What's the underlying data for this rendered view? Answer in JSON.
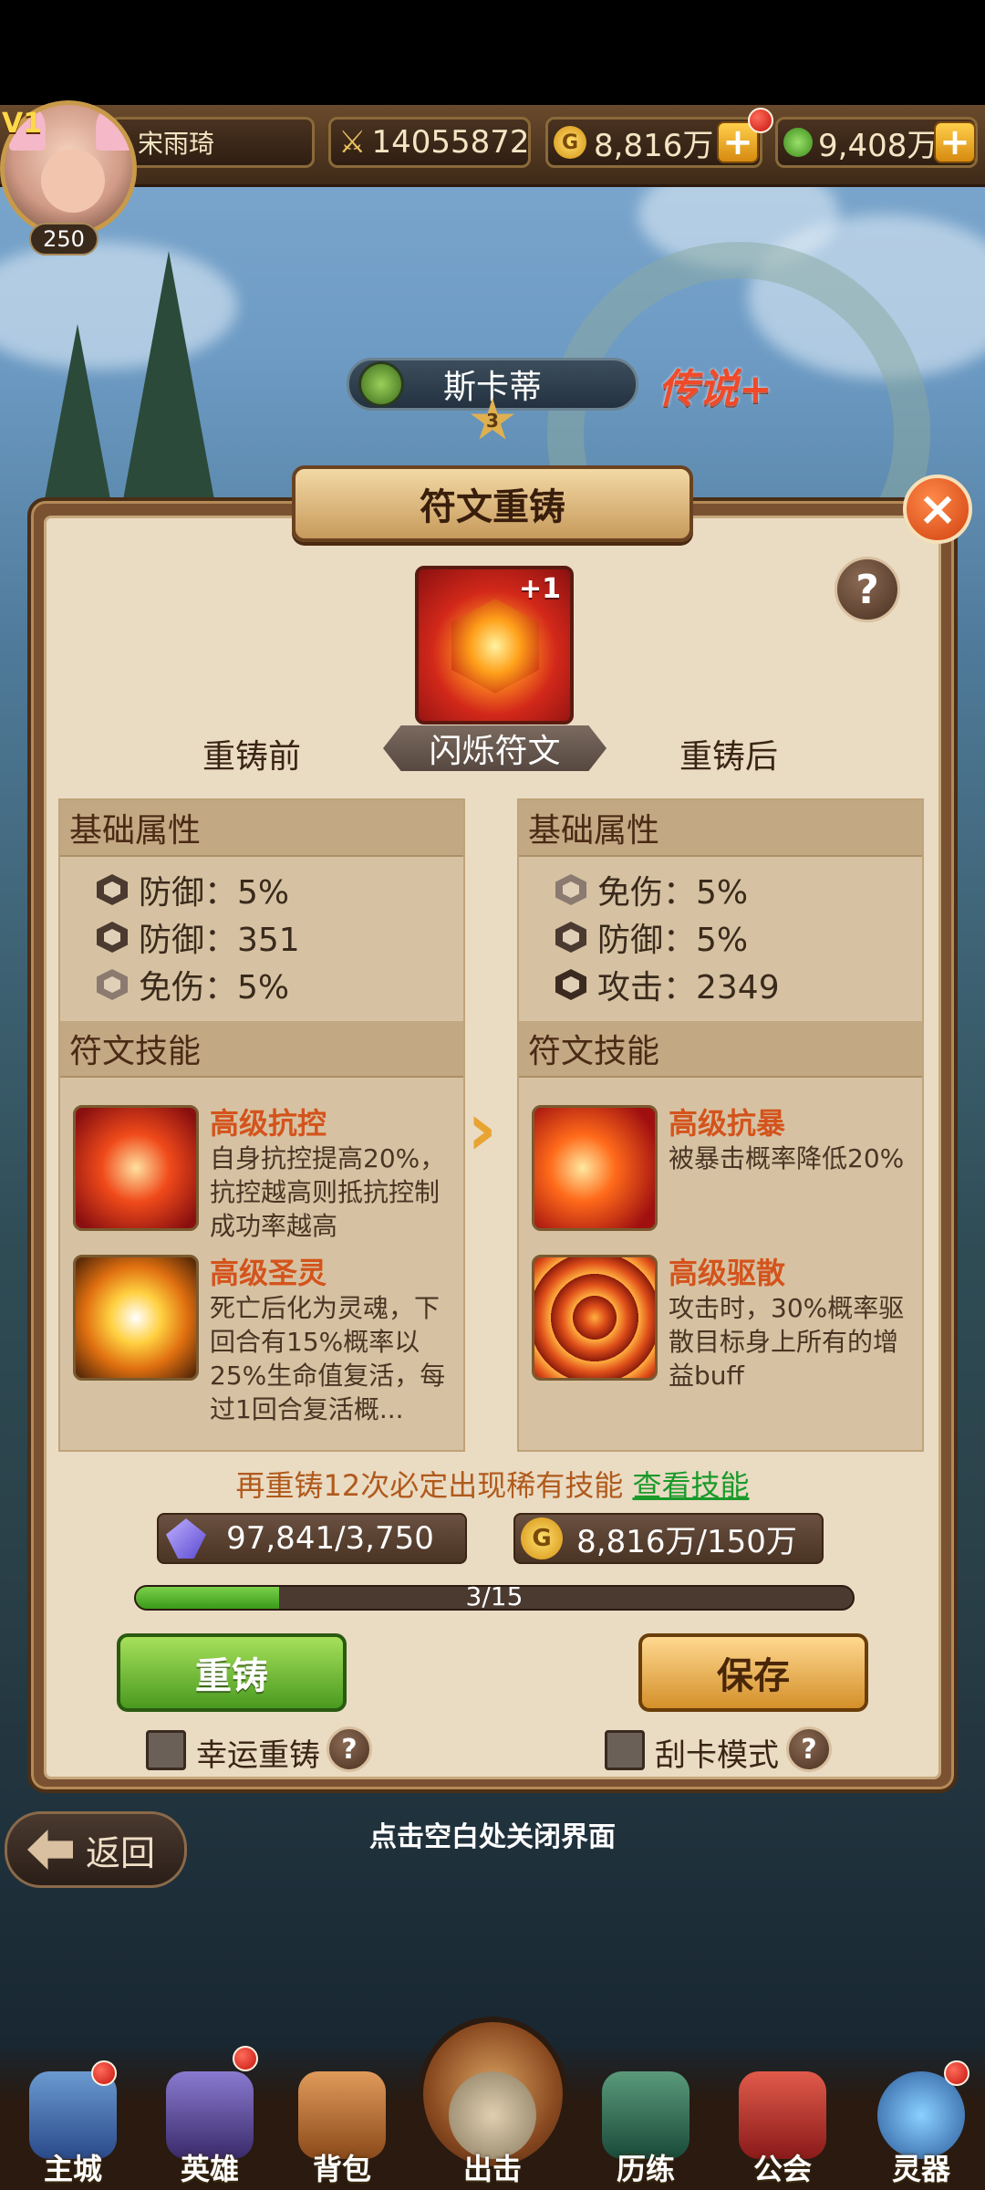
{
  "player": {
    "vip": "V1",
    "name": "宋雨琦",
    "level": "250"
  },
  "resources": {
    "power": "14055872",
    "gold": "8,816万",
    "potion": "9,408万"
  },
  "hero": {
    "name": "斯卡蒂",
    "stars": "3",
    "rarity": "传说+"
  },
  "dialog": {
    "title": "符文重铸",
    "rune_name": "闪烁符文",
    "rune_badge": "+1",
    "before_label": "重铸前",
    "after_label": "重铸后"
  },
  "before": {
    "basic_title": "基础属性",
    "attrs": [
      {
        "text": "防御：5%"
      },
      {
        "text": "防御：351"
      },
      {
        "text": "免伤：5%"
      }
    ],
    "skill_title": "符文技能",
    "skills": [
      {
        "name": "高级抗控",
        "desc": "自身抗控提高20%，抗控越高则抵抗控制成功率越高"
      },
      {
        "name": "高级圣灵",
        "desc": "死亡后化为灵魂，下回合有15%概率以25%生命值复活，每过1回合复活概..."
      }
    ]
  },
  "after": {
    "basic_title": "基础属性",
    "attrs": [
      {
        "text": "免伤：5%"
      },
      {
        "text": "防御：5%"
      },
      {
        "text": "攻击：2349"
      }
    ],
    "skill_title": "符文技能",
    "skills": [
      {
        "name": "高级抗暴",
        "desc": "被暴击概率降低20%"
      },
      {
        "name": "高级驱散",
        "desc": "攻击时，30%概率驱散目标身上所有的增益buff"
      }
    ]
  },
  "hint": {
    "text": "再重铸12次必定出现稀有技能",
    "link": "查看技能"
  },
  "costs": {
    "crystal": "97,841/3,750",
    "gold": "8,816万/150万"
  },
  "progress": {
    "text": "3/15",
    "value": 3,
    "max": 15
  },
  "buttons": {
    "recast": "重铸",
    "save": "保存",
    "lucky": "幸运重铸",
    "scratch": "刮卡模式",
    "back": "返回",
    "close_hint": "点击空白处关闭界面",
    "help": "?",
    "close": "×"
  },
  "nav": [
    {
      "label": "主城"
    },
    {
      "label": "英雄"
    },
    {
      "label": "背包"
    },
    {
      "label": "出击"
    },
    {
      "label": "历练"
    },
    {
      "label": "公会"
    },
    {
      "label": "灵器"
    }
  ],
  "colors": {
    "accent": "#d4531c",
    "link": "#1a9a2a",
    "recast_btn": "#4a9a20",
    "save_btn": "#d4902a"
  }
}
